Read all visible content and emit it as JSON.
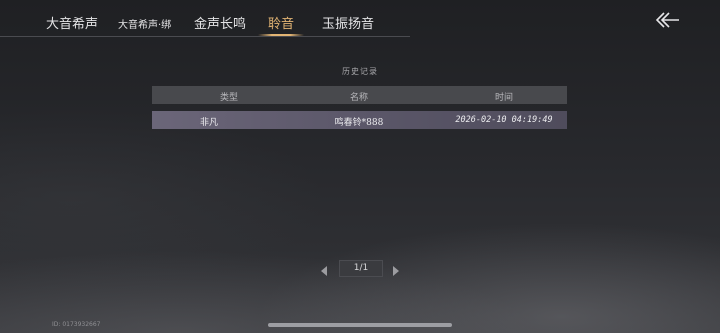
{
  "tabs": [
    {
      "label": "大音希声",
      "active": false
    },
    {
      "label": "大音希声·绑",
      "active": false
    },
    {
      "label": "金声长鸣",
      "active": false
    },
    {
      "label": "聆音",
      "active": true
    },
    {
      "label": "玉振扬音",
      "active": false
    }
  ],
  "back_icon": "back-arrow-icon",
  "section_title": "历史记录",
  "table": {
    "columns": [
      "类型",
      "名称",
      "时间"
    ],
    "rows": [
      {
        "type": "非凡",
        "name": "鸣春铃*888",
        "time": "2026-02-10 04:19:49"
      }
    ]
  },
  "pagination": {
    "text": "1/1"
  },
  "footer": {
    "id_text": "ID: 0173932667"
  },
  "colors": {
    "accent": "#e3b574",
    "row_highlight": "#5b5769",
    "header_bg": "#48494d"
  }
}
